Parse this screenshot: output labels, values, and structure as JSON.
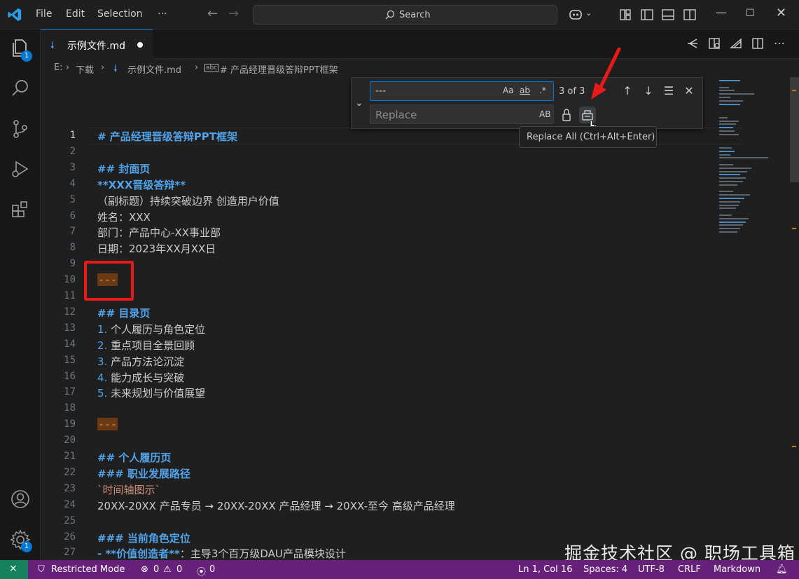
{
  "titlebar": {
    "menu": [
      "File",
      "Edit",
      "Selection",
      "···"
    ],
    "search_label": "Search"
  },
  "tab": {
    "label": "示例文件.md",
    "dirty": true
  },
  "breadcrumb": {
    "drive": "E:",
    "folder": "下载",
    "file": "示例文件.md",
    "symbol": "# 产品经理晋级答辩PPT框架"
  },
  "find_widget": {
    "find_value": "---",
    "options": [
      "Aa",
      "ab",
      ".*"
    ],
    "count": "3 of 3",
    "replace_placeholder": "Replace",
    "preserve_case": "AB",
    "tooltip": "Replace All (Ctrl+Alt+Enter)"
  },
  "editor": {
    "lines": [
      {
        "n": "1",
        "text": "# 产品经理晋级答辩PPT框架",
        "style": "heading"
      },
      {
        "n": "2",
        "text": "",
        "style": "plain"
      },
      {
        "n": "3",
        "text": "## 封面页",
        "style": "heading"
      },
      {
        "n": "4",
        "text": "**XXX晋级答辩**",
        "style": "bold"
      },
      {
        "n": "5",
        "text": "（副标题）持续突破边界 创造用户价值",
        "style": "plain"
      },
      {
        "n": "6",
        "text": "姓名：XXX",
        "style": "plain"
      },
      {
        "n": "7",
        "text": "部门：产品中心-XX事业部",
        "style": "plain"
      },
      {
        "n": "8",
        "text": "日期：2023年XX月XX日",
        "style": "plain"
      },
      {
        "n": "9",
        "text": "",
        "style": "plain"
      },
      {
        "n": "10",
        "text": "---",
        "style": "match"
      },
      {
        "n": "11",
        "text": "",
        "style": "plain"
      },
      {
        "n": "12",
        "text": "## 目录页",
        "style": "heading"
      },
      {
        "n": "13",
        "num": "1.",
        "text": " 个人履历与角色定位",
        "style": "list"
      },
      {
        "n": "14",
        "num": "2.",
        "text": " 重点项目全景回顾",
        "style": "list"
      },
      {
        "n": "15",
        "num": "3.",
        "text": " 产品方法论沉淀",
        "style": "list"
      },
      {
        "n": "16",
        "num": "4.",
        "text": " 能力成长与突破",
        "style": "list"
      },
      {
        "n": "17",
        "num": "5.",
        "text": " 未来规划与价值展望",
        "style": "list"
      },
      {
        "n": "18",
        "text": "",
        "style": "plain"
      },
      {
        "n": "19",
        "text": "---",
        "style": "match"
      },
      {
        "n": "20",
        "text": "",
        "style": "plain"
      },
      {
        "n": "21",
        "text": "## 个人履历页",
        "style": "heading"
      },
      {
        "n": "22",
        "text": "### 职业发展路径",
        "style": "heading"
      },
      {
        "n": "23",
        "text": "`时间轴图示`",
        "style": "orange"
      },
      {
        "n": "24",
        "text": "20XX-20XX 产品专员 → 20XX-20XX 产品经理 → 20XX-至今 高级产品经理",
        "style": "plain"
      },
      {
        "n": "25",
        "text": "",
        "style": "plain"
      },
      {
        "n": "26",
        "text": "### 当前角色定位",
        "style": "heading"
      },
      {
        "n": "27",
        "num": "- **价值创造者**",
        "text": "：主导3个百万级DAU产品模块设计",
        "style": "list"
      }
    ]
  },
  "watermark": "掘金技术社区 @ 职场工具箱",
  "statusbar": {
    "restricted": "Restricted Mode",
    "errors": "0",
    "warnings": "0",
    "ports": "0",
    "position": "Ln 1, Col 16",
    "spaces": "Spaces: 4",
    "encoding": "UTF-8",
    "eol": "CRLF",
    "language": "Markdown"
  },
  "badges": {
    "explorer": "1",
    "settings": "1"
  },
  "colors": {
    "accent": "#0078d4",
    "status_bar": "#68217a",
    "match_highlight": "#6b3a13",
    "annotation": "#e81919"
  }
}
